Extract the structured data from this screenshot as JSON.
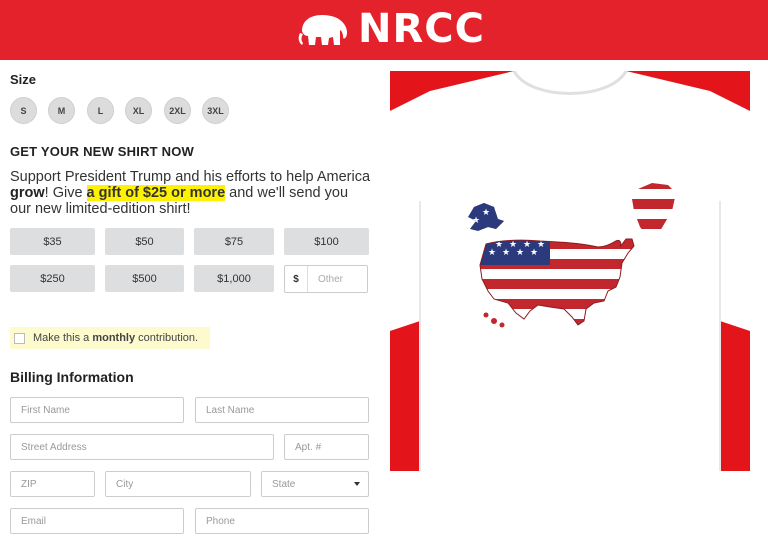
{
  "brand": {
    "name": "NRCC",
    "logo_icon": "elephant-icon",
    "bar_color": "#e4222b"
  },
  "size": {
    "label": "Size",
    "options": [
      "S",
      "M",
      "L",
      "XL",
      "2XL",
      "3XL"
    ]
  },
  "promo": {
    "heading": "GET YOUR NEW SHIRT NOW",
    "text_before": "Support President Trump and his efforts to help America ",
    "text_bold": "grow",
    "text_mid": "! Give ",
    "text_highlight": "a gift of $25 or more",
    "text_after": " and we'll send you our new limited-edition shirt!",
    "highlight_color": "#fff200"
  },
  "amounts": [
    "$35",
    "$50",
    "$75",
    "$100",
    "$250",
    "$500",
    "$1,000"
  ],
  "other_amount": {
    "currency": "$",
    "placeholder": "Other"
  },
  "monthly": {
    "before": "Make this a ",
    "bold": "monthly",
    "after": " contribution."
  },
  "billing": {
    "label": "Billing Information",
    "first_name": "First Name",
    "last_name": "Last Name",
    "street": "Street Address",
    "apt": "Apt. #",
    "zip": "ZIP",
    "city": "City",
    "state": "State",
    "email": "Email",
    "phone": "Phone"
  },
  "product_image": {
    "background_color": "#e3141a",
    "description_icon": "flag-map-shirt-image"
  }
}
